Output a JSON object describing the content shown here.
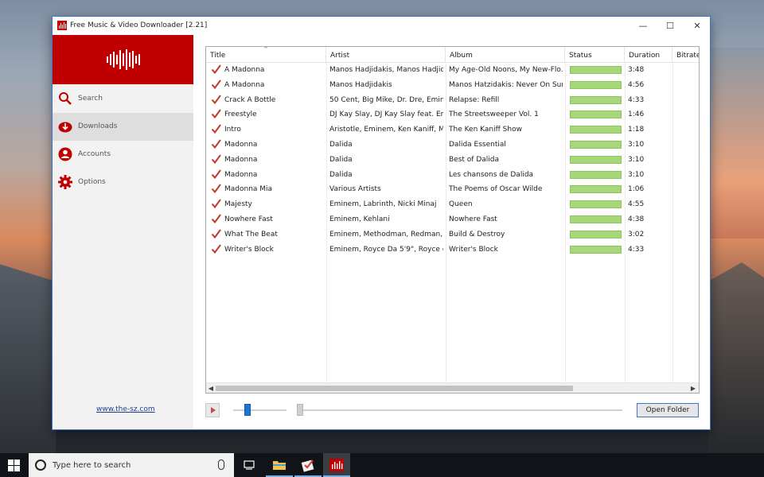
{
  "window": {
    "title": "Free Music & Video Downloader [2.21]",
    "controls": {
      "minimize": "—",
      "maximize": "☐",
      "close": "✕"
    }
  },
  "sidebar": {
    "items": [
      {
        "label": "Search",
        "icon": "search-icon"
      },
      {
        "label": "Downloads",
        "icon": "download-icon",
        "active": true
      },
      {
        "label": "Accounts",
        "icon": "account-icon"
      },
      {
        "label": "Options",
        "icon": "gear-icon"
      }
    ],
    "link": "www.the-sz.com"
  },
  "table": {
    "columns": [
      "Title",
      "Artist",
      "Album",
      "Status",
      "Duration",
      "Bitrate"
    ],
    "sort_indicator": "^",
    "rows": [
      {
        "title": "A Madonna",
        "artist": "Manos Hadjidakis, Manos Hadjid...",
        "album": "My Age-Old Noons, My New-Flo...",
        "status": 1.0,
        "duration": "3:48"
      },
      {
        "title": "A Madonna",
        "artist": "Manos Hadjidakis",
        "album": "Manos Hatzidakis: Never On Sun",
        "status": 1.0,
        "duration": "4:56"
      },
      {
        "title": "Crack A Bottle",
        "artist": "50 Cent, Big Mike, Dr. Dre, Eminem",
        "album": "Relapse: Refill",
        "status": 1.0,
        "duration": "4:33"
      },
      {
        "title": "Freestyle",
        "artist": "DJ Kay Slay, DJ Kay Slay feat. Emi...",
        "album": "The Streetsweeper Vol. 1",
        "status": 1.0,
        "duration": "1:46"
      },
      {
        "title": "Intro",
        "artist": "Aristotle, Eminem, Ken Kaniff, Ma...",
        "album": "The Ken Kaniff Show",
        "status": 1.0,
        "duration": "1:18"
      },
      {
        "title": "Madonna",
        "artist": "Dalida",
        "album": "Dalida Essential",
        "status": 1.0,
        "duration": "3:10"
      },
      {
        "title": "Madonna",
        "artist": "Dalida",
        "album": "Best of Dalida",
        "status": 1.0,
        "duration": "3:10"
      },
      {
        "title": "Madonna",
        "artist": "Dalida",
        "album": "Les chansons de Dalida",
        "status": 1.0,
        "duration": "3:10"
      },
      {
        "title": "Madonna Mia",
        "artist": "Various Artists",
        "album": "The Poems of Oscar Wilde",
        "status": 1.0,
        "duration": "1:06"
      },
      {
        "title": "Majesty",
        "artist": "Eminem, Labrinth, Nicki Minaj",
        "album": "Queen",
        "status": 1.0,
        "duration": "4:55"
      },
      {
        "title": "Nowhere Fast",
        "artist": "Eminem, Kehlani",
        "album": "Nowhere Fast",
        "status": 1.0,
        "duration": "4:38"
      },
      {
        "title": "What The Beat",
        "artist": "Eminem, Methodman, Redman, ...",
        "album": "Build & Destroy",
        "status": 1.0,
        "duration": "3:02"
      },
      {
        "title": "Writer's Block",
        "artist": "Eminem, Royce Da 5'9\", Royce da...",
        "album": "Writer's Block",
        "status": 1.0,
        "duration": "4:33"
      }
    ]
  },
  "player": {
    "open_folder_label": "Open Folder"
  },
  "taskbar": {
    "search_placeholder": "Type here to search",
    "apps": [
      "task-view-icon",
      "file-explorer-icon",
      "checklist-app-icon",
      "music-downloader-icon"
    ]
  },
  "colors": {
    "accent": "#c00000",
    "status_done": "#a8d77a",
    "link": "#1a3f8f",
    "selection_border": "#3a78c9"
  }
}
